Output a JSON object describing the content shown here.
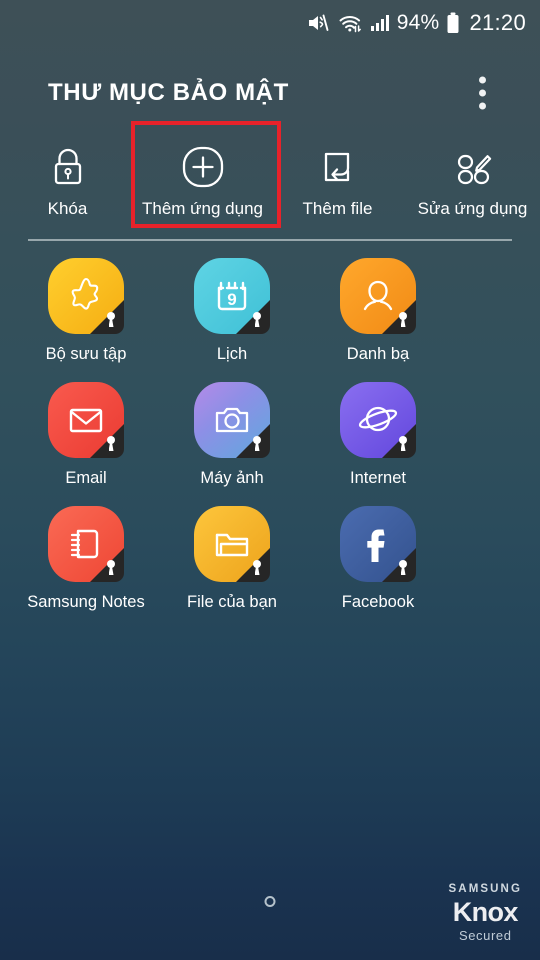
{
  "statusbar": {
    "icons": [
      "mute-icon",
      "wifi-transfer-icon",
      "signal-bars-icon"
    ],
    "battery_percent": "94%",
    "battery_icon": "battery-full-icon",
    "clock": "21:20"
  },
  "header": {
    "title": "THƯ MỤC BẢO MẬT",
    "overflow_icon": "more-vertical-icon"
  },
  "toolbar": {
    "items": [
      {
        "label": "Khóa",
        "icon": "padlock-icon",
        "highlighted": false
      },
      {
        "label": "Thêm ứng dụng",
        "icon": "plus-circle-icon",
        "highlighted": true
      },
      {
        "label": "Thêm file",
        "icon": "add-file-icon",
        "highlighted": false
      },
      {
        "label": "Sửa ứng dụng",
        "icon": "edit-apps-icon",
        "highlighted": false
      }
    ],
    "highlight_color": "#e8222a"
  },
  "apps": [
    {
      "label": "Bộ sưu tập",
      "icon": "gallery-icon",
      "color": "#f9bf1e",
      "locked": true
    },
    {
      "label": "Lịch",
      "icon": "calendar-icon",
      "color": "#4ec8dc",
      "locked": true,
      "badge_number": "9"
    },
    {
      "label": "Danh bạ",
      "icon": "contacts-icon",
      "color": "#f79a20",
      "locked": true
    },
    {
      "label": "Email",
      "icon": "email-icon",
      "color": "#f0463c",
      "locked": true
    },
    {
      "label": "Máy ảnh",
      "icon": "camera-icon",
      "color": "#8f7be8",
      "locked": true
    },
    {
      "label": "Internet",
      "icon": "internet-icon",
      "color": "#6e56e0",
      "locked": true
    },
    {
      "label": "Samsung Notes",
      "icon": "samsung-notes-icon",
      "color": "#f15a4a",
      "locked": true
    },
    {
      "label": "File của bạn",
      "icon": "my-files-icon",
      "color": "#f2b52c",
      "locked": true
    },
    {
      "label": "Facebook",
      "icon": "facebook-icon",
      "color": "#3b5a9b",
      "locked": true
    }
  ],
  "footer": {
    "home_indicator": "home-dot-icon",
    "watermark_line1": "SAMSUNG",
    "watermark_line2": "Knox",
    "watermark_line3": "Secured"
  }
}
